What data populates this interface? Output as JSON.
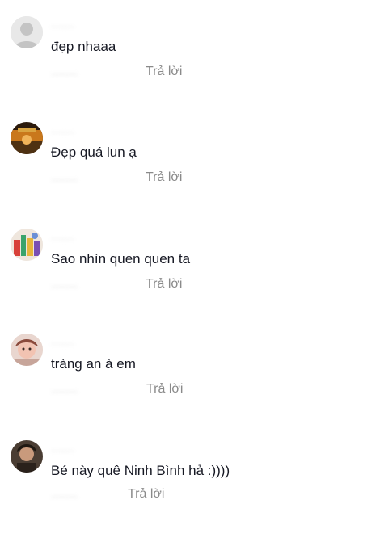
{
  "comments": [
    {
      "username": "........",
      "text": "đẹp nhaaa",
      "time": "........",
      "reply": "Trả lời",
      "avatar": "default-avatar"
    },
    {
      "username": "........",
      "text": "Đẹp quá lun ạ",
      "time": "........",
      "reply": "Trả lời",
      "avatar": "user-avatar"
    },
    {
      "username": "........",
      "text": "Sao nhìn quen quen ta",
      "time": "........",
      "reply": "Trả lời",
      "avatar": "user-avatar"
    },
    {
      "username": "........",
      "text": "tràng an à em",
      "time": "........",
      "reply": "Trả lời",
      "avatar": "user-avatar"
    },
    {
      "username": "........",
      "text": "Bé này quê Ninh Bình hả :))))",
      "time": "........",
      "reply": "Trả lời",
      "avatar": "user-avatar"
    }
  ]
}
